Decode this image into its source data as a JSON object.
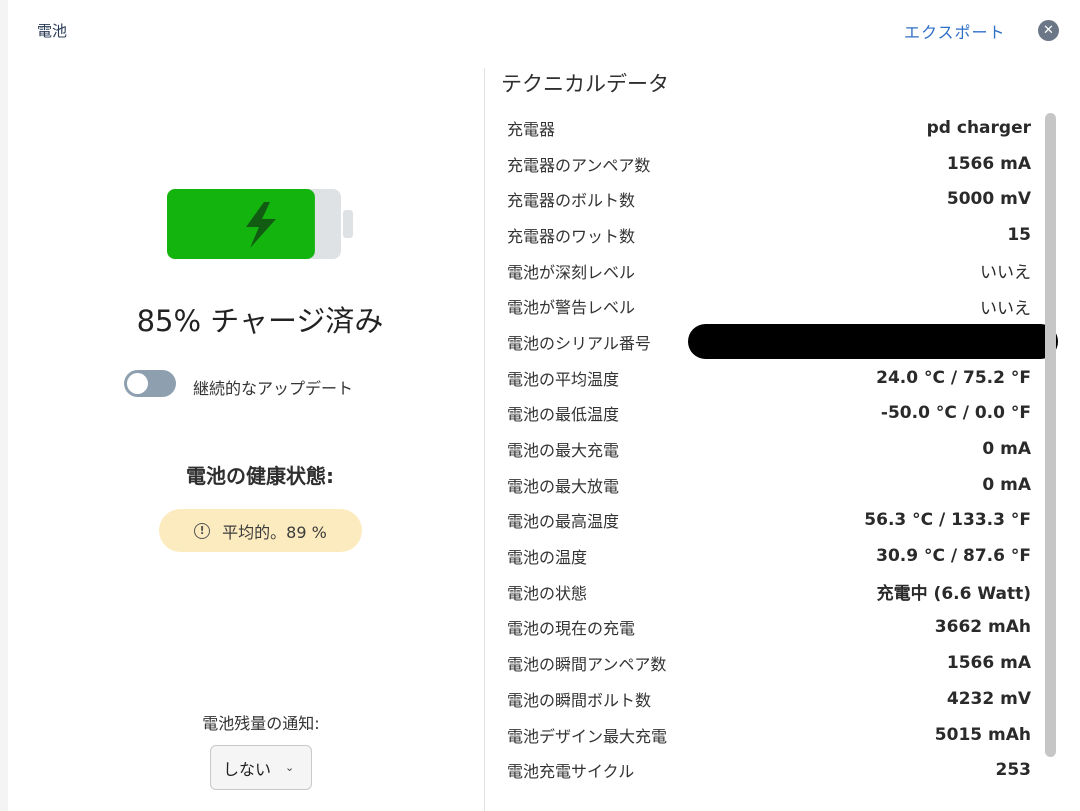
{
  "header": {
    "title": "電池",
    "export_label": "エクスポート",
    "close_symbol": "✕"
  },
  "battery": {
    "charge_percent": 85,
    "charge_text": "85% チャージ済み",
    "fill_color": "#14b40f",
    "icon": "lightning-bolt-icon"
  },
  "continuous_update": {
    "label": "継続的なアップデート",
    "enabled": false
  },
  "health": {
    "title": "電池の健康状態:",
    "badge_text": "平均的。89 %",
    "badge_icon": "exclamation-circle-icon",
    "badge_color": "#fcebbf"
  },
  "notification": {
    "label": "電池残量の通知:",
    "selected": "しない"
  },
  "technical": {
    "title": "テクニカルデータ",
    "rows": [
      {
        "key": "充電器",
        "value": "pd charger"
      },
      {
        "key": "充電器のアンペア数",
        "value": "1566 mA"
      },
      {
        "key": "充電器のボルト数",
        "value": "5000 mV"
      },
      {
        "key": "充電器のワット数",
        "value": "15"
      },
      {
        "key": "電池が深刻レベル",
        "value": "いいえ"
      },
      {
        "key": "電池が警告レベル",
        "value": "いいえ"
      },
      {
        "key": "電池のシリアル番号",
        "value": ""
      },
      {
        "key": "電池の平均温度",
        "value": "24.0 °C / 75.2 °F"
      },
      {
        "key": "電池の最低温度",
        "value": "-50.0 °C / 0.0 °F"
      },
      {
        "key": "電池の最大充電",
        "value": "0 mA"
      },
      {
        "key": "電池の最大放電",
        "value": "0 mA"
      },
      {
        "key": "電池の最高温度",
        "value": "56.3 °C / 133.3 °F"
      },
      {
        "key": "電池の温度",
        "value": "30.9 °C / 87.6 °F"
      },
      {
        "key": "電池の状態",
        "value": "充電中 (6.6 Watt)"
      },
      {
        "key": "電池の現在の充電",
        "value": "3662 mAh"
      },
      {
        "key": "電池の瞬間アンペア数",
        "value": "1566 mA"
      },
      {
        "key": "電池の瞬間ボルト数",
        "value": "4232 mV"
      },
      {
        "key": "電池デザイン最大充電",
        "value": "5015 mAh"
      },
      {
        "key": "電池充電サイクル",
        "value": "253"
      }
    ]
  }
}
